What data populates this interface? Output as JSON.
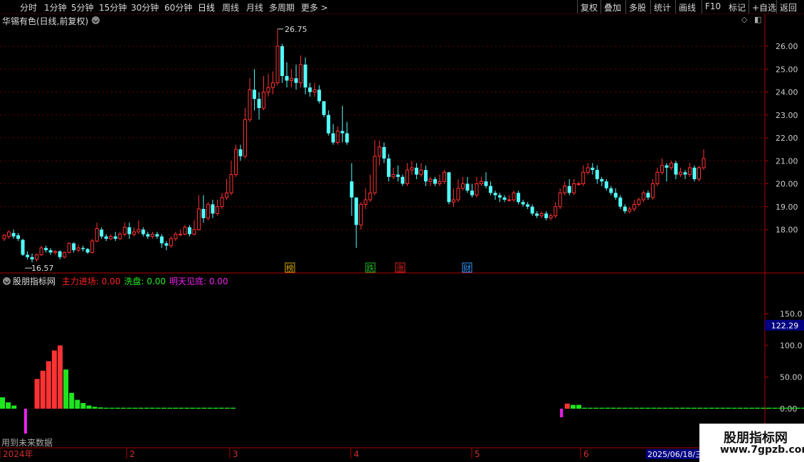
{
  "toolbar": {
    "left_items": [
      "分时",
      "1分钟",
      "5分钟",
      "15分钟",
      "30分钟",
      "60分钟",
      "日线",
      "周线",
      "月线",
      "多周期",
      "更多 >"
    ],
    "active": "日线",
    "right_items": [
      "复权",
      "叠加",
      "多股",
      "统计",
      "画线",
      "F10",
      "+自选",
      "返回"
    ],
    "extra": "标记"
  },
  "stock": {
    "title": "华锡有色(日线,前复权)"
  },
  "price_chart": {
    "high_label": "26.75",
    "low_label": "16.57",
    "y_ticks": [
      "26.00",
      "25.00",
      "24.00",
      "23.00",
      "22.00",
      "21.00",
      "20.00",
      "19.00",
      "18.00"
    ],
    "markers": [
      {
        "text": "榜",
        "color": "#d4a500"
      },
      {
        "text": "跌",
        "color": "#22bb22"
      },
      {
        "text": "涨",
        "color": "#dd2222"
      },
      {
        "text": "财",
        "color": "#3399ff"
      }
    ]
  },
  "indicator": {
    "name": "股朋指标网",
    "fields": [
      {
        "label": "主力进场:",
        "value": "0.00",
        "color": "#ff2020"
      },
      {
        "label": "洗盘:",
        "value": "0.00",
        "color": "#22ee22"
      },
      {
        "label": "明天见底:",
        "value": "0.00",
        "color": "#ee22ee"
      }
    ],
    "y_ticks": [
      "150.0",
      "100.0",
      "50.00",
      "0.00"
    ],
    "cursor_value": "122.29",
    "future_note": "用到未来数据"
  },
  "timeline": {
    "labels": [
      "2024年",
      "2",
      "3",
      "4",
      "5",
      "6"
    ],
    "date_box": "2025/06/18/三"
  },
  "watermark": {
    "line1": "股朋指标网",
    "line2": "www.7gpzb.com"
  },
  "colors": {
    "up": "#ff3232",
    "down": "#54ffff",
    "green": "#1ee61e",
    "magenta": "#ee22ee",
    "axis": "#b00000"
  },
  "chart_data": {
    "type": "candlestick",
    "candles": [
      [
        17.6,
        17.75,
        17.5,
        17.8
      ],
      [
        17.7,
        17.9,
        17.6,
        17.95
      ],
      [
        17.85,
        17.7,
        17.6,
        18.0
      ],
      [
        17.75,
        17.6,
        17.5,
        17.85
      ],
      [
        17.55,
        16.9,
        16.85,
        17.6
      ],
      [
        16.9,
        16.8,
        16.7,
        17.05
      ],
      [
        16.8,
        16.7,
        16.57,
        16.95
      ],
      [
        16.7,
        16.9,
        16.6,
        16.95
      ],
      [
        16.9,
        17.2,
        16.85,
        17.3
      ],
      [
        17.2,
        17.1,
        17.0,
        17.3
      ],
      [
        17.1,
        17.0,
        16.9,
        17.2
      ],
      [
        17.0,
        17.05,
        16.9,
        17.1
      ],
      [
        17.05,
        16.8,
        16.7,
        17.1
      ],
      [
        16.8,
        17.0,
        16.75,
        17.05
      ],
      [
        17.0,
        17.4,
        16.95,
        17.45
      ],
      [
        17.4,
        17.1,
        17.0,
        17.45
      ],
      [
        17.1,
        17.2,
        17.0,
        17.35
      ],
      [
        17.2,
        17.15,
        17.05,
        17.3
      ],
      [
        17.15,
        17.0,
        16.95,
        17.2
      ],
      [
        17.0,
        17.5,
        16.95,
        17.6
      ],
      [
        17.5,
        18.05,
        17.45,
        18.3
      ],
      [
        18.0,
        17.7,
        17.6,
        18.1
      ],
      [
        17.7,
        17.6,
        17.5,
        17.8
      ],
      [
        17.6,
        17.7,
        17.55,
        17.8
      ],
      [
        17.7,
        17.6,
        17.5,
        17.9
      ],
      [
        17.6,
        17.8,
        17.55,
        17.9
      ],
      [
        17.8,
        18.1,
        17.7,
        18.3
      ],
      [
        18.1,
        17.8,
        17.6,
        18.3
      ],
      [
        17.8,
        17.9,
        17.7,
        18.1
      ],
      [
        17.9,
        18.0,
        17.8,
        18.4
      ],
      [
        18.0,
        17.8,
        17.7,
        18.1
      ],
      [
        17.8,
        17.7,
        17.6,
        17.9
      ],
      [
        17.7,
        17.8,
        17.6,
        17.9
      ],
      [
        17.8,
        17.7,
        17.6,
        17.9
      ],
      [
        17.7,
        17.4,
        17.2,
        17.8
      ],
      [
        17.4,
        17.3,
        17.1,
        17.5
      ],
      [
        17.3,
        17.6,
        17.2,
        17.7
      ],
      [
        17.6,
        17.8,
        17.5,
        17.9
      ],
      [
        17.8,
        17.8,
        17.7,
        18.0
      ],
      [
        17.8,
        18.1,
        17.75,
        18.2
      ],
      [
        18.1,
        17.8,
        17.7,
        18.2
      ],
      [
        17.8,
        18.0,
        17.75,
        18.4
      ],
      [
        18.0,
        18.9,
        17.95,
        19.5
      ],
      [
        18.9,
        18.5,
        18.3,
        19.5
      ],
      [
        18.5,
        19.1,
        18.4,
        19.2
      ],
      [
        19.1,
        18.7,
        18.5,
        19.3
      ],
      [
        18.7,
        19.0,
        18.6,
        19.3
      ],
      [
        19.0,
        19.4,
        18.9,
        19.6
      ],
      [
        19.4,
        19.6,
        19.3,
        20.2
      ],
      [
        19.6,
        20.4,
        19.5,
        21.0
      ],
      [
        20.4,
        21.5,
        20.3,
        21.7
      ],
      [
        21.5,
        21.2,
        21.0,
        21.7
      ],
      [
        21.2,
        22.8,
        21.1,
        23.3
      ],
      [
        22.8,
        24.1,
        22.7,
        24.6
      ],
      [
        24.1,
        23.7,
        23.2,
        25.0
      ],
      [
        23.7,
        23.3,
        22.8,
        24.0
      ],
      [
        23.3,
        24.0,
        23.2,
        24.7
      ],
      [
        24.0,
        24.2,
        23.8,
        24.8
      ],
      [
        24.2,
        24.4,
        23.9,
        24.9
      ],
      [
        24.4,
        26.0,
        24.3,
        26.75
      ],
      [
        26.0,
        24.7,
        24.4,
        26.1
      ],
      [
        24.7,
        24.5,
        24.2,
        25.3
      ],
      [
        24.5,
        24.6,
        24.2,
        25.0
      ],
      [
        24.6,
        24.4,
        24.1,
        25.2
      ],
      [
        24.4,
        25.2,
        24.2,
        25.6
      ],
      [
        25.2,
        24.2,
        23.9,
        25.5
      ],
      [
        24.2,
        24.0,
        23.8,
        24.4
      ],
      [
        24.0,
        24.1,
        23.8,
        24.4
      ],
      [
        24.1,
        23.6,
        23.5,
        24.3
      ],
      [
        23.6,
        23.0,
        22.9,
        23.6
      ],
      [
        23.0,
        22.2,
        22.1,
        23.2
      ],
      [
        22.2,
        21.8,
        21.7,
        22.6
      ],
      [
        21.8,
        22.3,
        21.7,
        22.5
      ],
      [
        22.3,
        22.2,
        21.8,
        23.4
      ],
      [
        22.2,
        21.8,
        21.7,
        22.7
      ],
      [
        20.1,
        19.4,
        18.6,
        20.9
      ],
      [
        19.4,
        18.2,
        17.2,
        19.4
      ],
      [
        18.2,
        19.1,
        18.0,
        19.2
      ],
      [
        19.1,
        19.3,
        18.9,
        19.8
      ],
      [
        19.3,
        19.6,
        19.2,
        20.4
      ],
      [
        19.6,
        21.2,
        19.5,
        21.9
      ],
      [
        21.2,
        21.6,
        20.8,
        21.9
      ],
      [
        21.6,
        21.1,
        20.9,
        21.8
      ],
      [
        21.1,
        20.3,
        20.1,
        21.3
      ],
      [
        20.3,
        20.4,
        20.2,
        20.7
      ],
      [
        20.4,
        20.3,
        20.1,
        20.8
      ],
      [
        20.3,
        20.0,
        19.9,
        20.4
      ],
      [
        20.0,
        20.6,
        19.9,
        20.9
      ],
      [
        20.6,
        20.7,
        20.4,
        21.0
      ],
      [
        20.7,
        20.4,
        20.2,
        20.9
      ],
      [
        20.4,
        20.6,
        20.3,
        20.9
      ],
      [
        20.6,
        20.1,
        19.9,
        20.8
      ],
      [
        20.1,
        20.2,
        19.9,
        20.3
      ],
      [
        20.2,
        20.0,
        19.9,
        20.3
      ],
      [
        20.0,
        20.1,
        19.9,
        20.4
      ],
      [
        20.1,
        20.5,
        20.0,
        20.6
      ],
      [
        20.5,
        19.2,
        19.1,
        20.5
      ],
      [
        19.2,
        19.3,
        19.0,
        19.8
      ],
      [
        19.3,
        19.8,
        19.2,
        20.2
      ],
      [
        19.8,
        20.0,
        19.7,
        20.3
      ],
      [
        20.0,
        19.7,
        19.6,
        20.3
      ],
      [
        19.7,
        19.5,
        19.4,
        20.0
      ],
      [
        19.5,
        20.0,
        19.4,
        20.3
      ],
      [
        20.0,
        20.1,
        19.9,
        20.3
      ],
      [
        20.1,
        19.9,
        19.8,
        20.5
      ],
      [
        19.9,
        19.6,
        19.5,
        20.1
      ],
      [
        19.6,
        19.5,
        19.3,
        19.7
      ],
      [
        19.5,
        19.4,
        19.2,
        19.6
      ],
      [
        19.4,
        19.3,
        19.2,
        19.5
      ],
      [
        19.3,
        19.3,
        19.2,
        19.5
      ],
      [
        19.3,
        19.6,
        19.2,
        19.7
      ],
      [
        19.6,
        19.2,
        19.1,
        19.7
      ],
      [
        19.2,
        19.1,
        19.0,
        19.3
      ],
      [
        19.1,
        19.0,
        18.9,
        19.2
      ],
      [
        19.0,
        18.7,
        18.6,
        19.1
      ],
      [
        18.7,
        18.6,
        18.5,
        18.8
      ],
      [
        18.6,
        18.7,
        18.5,
        18.8
      ],
      [
        18.7,
        18.5,
        18.4,
        18.8
      ],
      [
        18.5,
        18.6,
        18.4,
        18.7
      ],
      [
        18.6,
        19.0,
        18.5,
        19.2
      ],
      [
        19.0,
        19.6,
        18.9,
        19.8
      ],
      [
        19.6,
        19.9,
        19.5,
        20.1
      ],
      [
        19.9,
        19.6,
        19.5,
        20.2
      ],
      [
        19.6,
        20.0,
        19.5,
        20.2
      ],
      [
        20.0,
        20.0,
        19.9,
        20.1
      ],
      [
        20.0,
        20.5,
        19.9,
        20.8
      ],
      [
        20.5,
        20.7,
        20.4,
        20.9
      ],
      [
        20.7,
        20.6,
        20.4,
        20.9
      ],
      [
        20.6,
        20.2,
        20.0,
        20.8
      ],
      [
        20.2,
        20.1,
        19.9,
        20.3
      ],
      [
        20.1,
        19.8,
        19.7,
        20.2
      ],
      [
        19.8,
        19.6,
        19.5,
        19.9
      ],
      [
        19.6,
        19.4,
        19.3,
        19.8
      ],
      [
        19.4,
        19.0,
        18.9,
        19.5
      ],
      [
        19.0,
        18.8,
        18.7,
        19.1
      ],
      [
        18.8,
        18.9,
        18.7,
        19.0
      ],
      [
        18.9,
        19.1,
        18.8,
        19.3
      ],
      [
        19.1,
        19.3,
        19.0,
        19.4
      ],
      [
        19.3,
        19.6,
        19.2,
        19.7
      ],
      [
        19.6,
        19.4,
        19.3,
        19.7
      ],
      [
        19.4,
        20.0,
        19.3,
        20.2
      ],
      [
        20.0,
        20.5,
        19.9,
        20.7
      ],
      [
        20.5,
        20.8,
        20.4,
        21.1
      ],
      [
        20.8,
        20.7,
        20.1,
        20.9
      ],
      [
        20.7,
        20.9,
        20.6,
        21.0
      ],
      [
        20.9,
        20.4,
        20.2,
        21.0
      ],
      [
        20.4,
        20.5,
        20.3,
        20.7
      ],
      [
        20.5,
        20.4,
        20.2,
        20.6
      ],
      [
        20.4,
        20.7,
        20.3,
        20.9
      ],
      [
        20.7,
        20.2,
        20.1,
        20.8
      ],
      [
        20.2,
        20.7,
        20.1,
        20.8
      ],
      [
        20.7,
        21.1,
        20.6,
        21.5
      ]
    ],
    "main": {
      "6": 47,
      "7": 60,
      "8": 75,
      "9": 92,
      "10": 100
    },
    "wash": {
      "0": 18,
      "1": 10,
      "2": 5,
      "11": 62,
      "12": 25,
      "13": 14,
      "14": 9,
      "15": 5,
      "16": 3,
      "17": 2
    },
    "wash_tail": [
      [
        18,
        40,
        1.5
      ],
      [
        99,
        100,
        6
      ],
      [
        101,
        140,
        1.5
      ],
      [
        188,
        195,
        1.8
      ],
      [
        196,
        218,
        1.2
      ]
    ],
    "main2": {
      "98": 8,
      "188": 15,
      "189": 22
    },
    "bottom": [
      [
        4,
        -35
      ],
      [
        97,
        -12
      ],
      [
        189,
        -42
      ]
    ]
  }
}
